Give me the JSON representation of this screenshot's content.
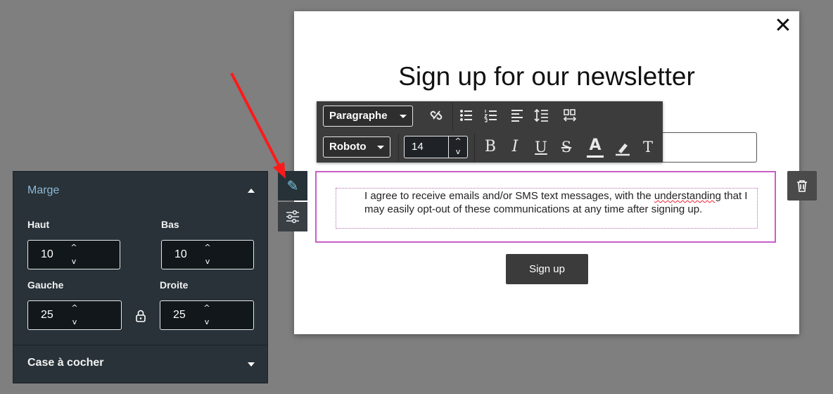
{
  "modal": {
    "close_glyph": "✕",
    "title": "Sign up for our newsletter",
    "consent_text_before": "I agree to receive emails and/or SMS text messages, with the ",
    "consent_text_misspelled": "understandin",
    "consent_text_after": "g that I may easily opt-out of these communications at any time after signing up.",
    "signup_label": "Sign up"
  },
  "toolbar": {
    "block_type": "Paragraphe",
    "font_family": "Roboto",
    "font_size": "14",
    "icons": [
      "unlink-icon",
      "bullet-list-icon",
      "numbered-list-icon",
      "align-left-icon",
      "line-height-icon",
      "letter-spacing-icon",
      "bold-icon",
      "italic-icon",
      "underline-icon",
      "strikethrough-icon",
      "text-color-icon",
      "highlight-icon",
      "clear-format-icon"
    ],
    "bold_glyph": "B",
    "italic_glyph": "I",
    "underline_glyph": "U",
    "strike_glyph": "S",
    "color_glyph": "A",
    "clear_glyph": "T"
  },
  "side_tools": {
    "edit_icon": "pencil-icon",
    "settings_icon": "sliders-icon",
    "delete_icon": "trash-icon"
  },
  "panel": {
    "section_title": "Marge",
    "haut_label": "Haut",
    "haut_value": "10",
    "bas_label": "Bas",
    "bas_value": "10",
    "gauche_label": "Gauche",
    "gauche_value": "25",
    "droite_label": "Droite",
    "droite_value": "25",
    "section2_title": "Case à cocher"
  },
  "colors": {
    "backdrop": "#7f7f7f",
    "panel_bg": "#283238",
    "accent_label": "#8fb9d6",
    "selection_border": "#c75fc7",
    "annotation_arrow": "#ff1a1a"
  }
}
